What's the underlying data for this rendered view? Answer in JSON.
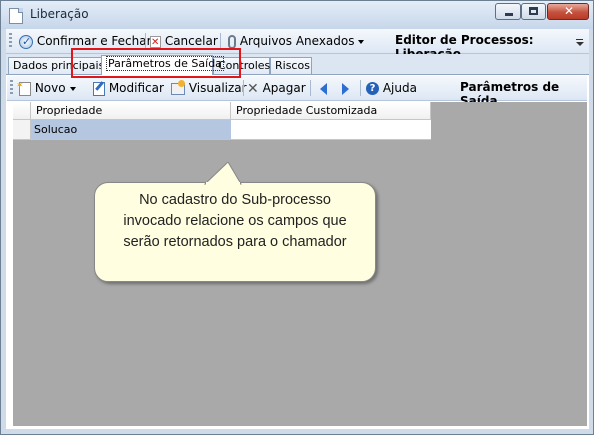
{
  "window": {
    "title": "Liberação"
  },
  "toolbar": {
    "confirm_label": "Confirmar e Fechar",
    "cancel_label": "Cancelar",
    "attachments_label": "Arquivos Anexados",
    "editor_label": "Editor de Processos: Liberação"
  },
  "tabs": [
    {
      "label": "Dados principais"
    },
    {
      "label": "Parâmetros de Saída"
    },
    {
      "label": "Controles"
    },
    {
      "label": "Riscos"
    }
  ],
  "panel": {
    "new_label": "Novo",
    "modify_label": "Modificar",
    "view_label": "Visualizar",
    "delete_label": "Apagar",
    "help_label": "Ajuda",
    "title": "Parâmetros de Saída"
  },
  "grid": {
    "columns": [
      "Propriedade",
      "Propriedade Customizada"
    ],
    "rows": [
      {
        "property": "Solucao",
        "custom": ""
      }
    ]
  },
  "callout": {
    "line1": "No cadastro do Sub-processo",
    "line2": "invocado relacione os campos que",
    "line3": "serão retornados para o chamador"
  },
  "colors": {
    "highlight": "#e0161a",
    "selected_row": "#b4c6e0",
    "grid_bg": "#a9a9a9",
    "callout_bg": "#fffee0"
  }
}
